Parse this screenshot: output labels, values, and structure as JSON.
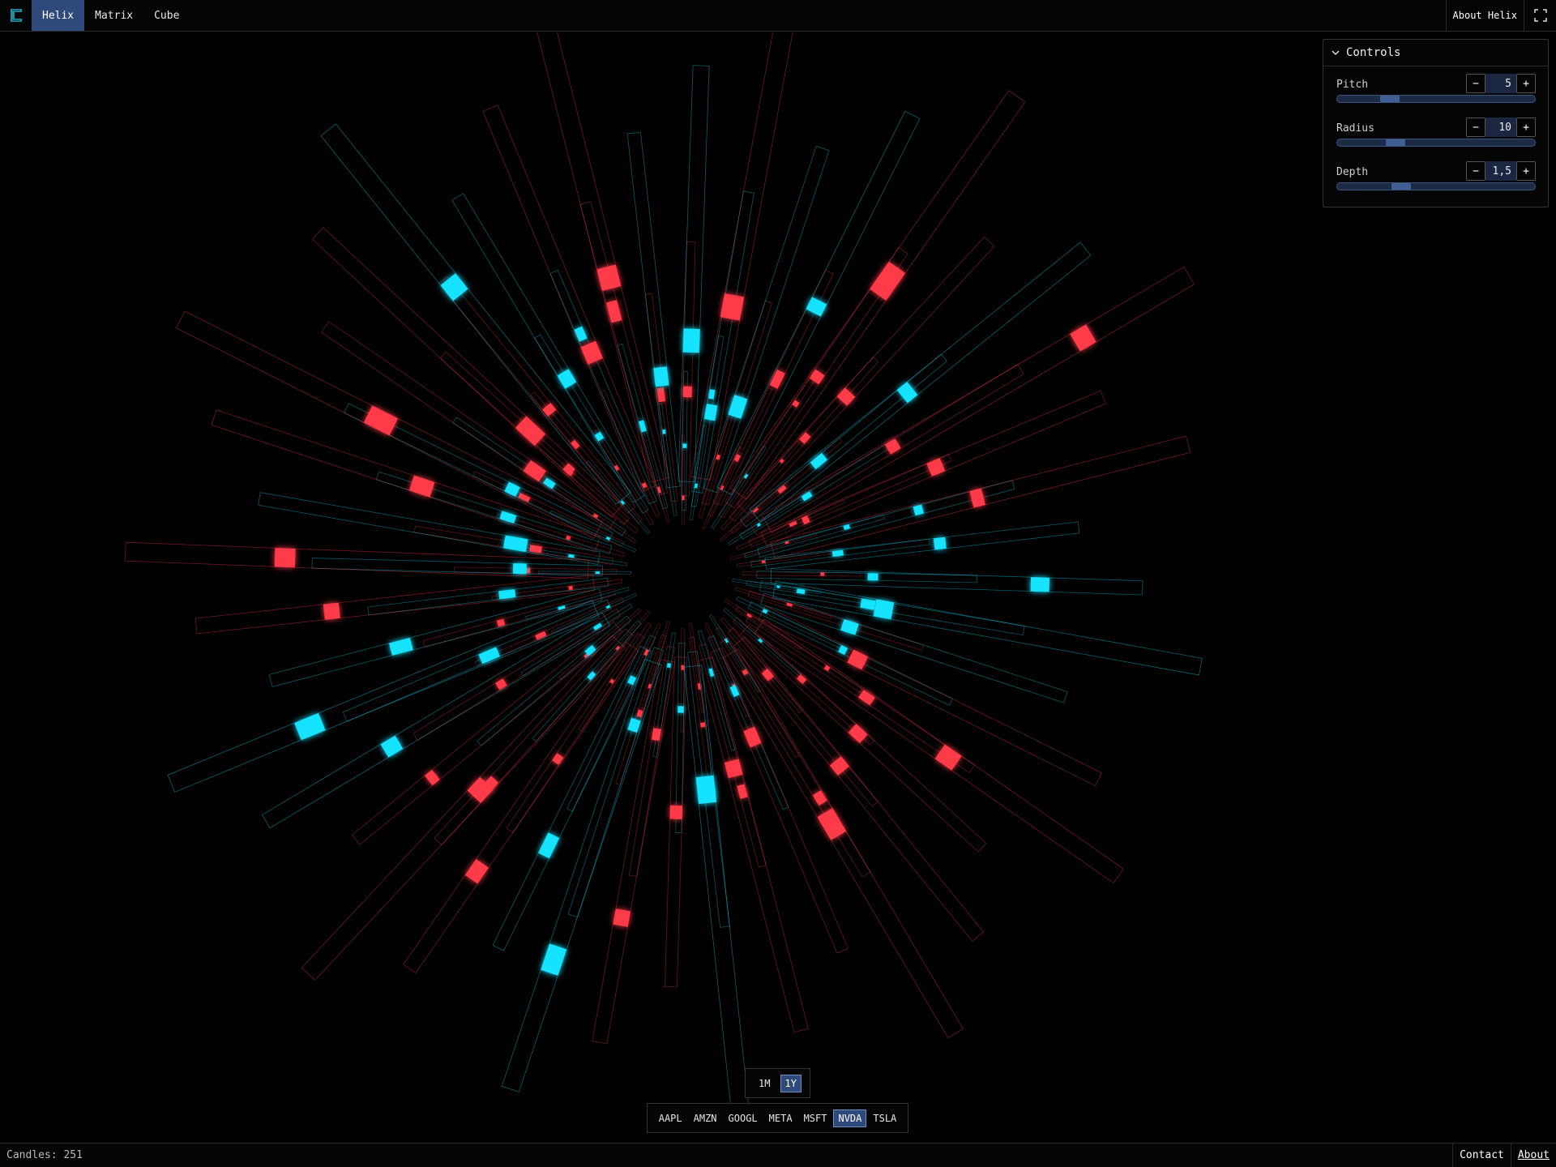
{
  "nav": {
    "logo_icon": "bracket-logo-icon",
    "tabs": [
      {
        "label": "Helix",
        "active": true
      },
      {
        "label": "Matrix",
        "active": false
      },
      {
        "label": "Cube",
        "active": false
      }
    ],
    "about_label": "About Helix",
    "fullscreen_icon": "fullscreen-icon"
  },
  "controls": {
    "title": "Controls",
    "toggle_icon": "chevron-down-icon",
    "params": [
      {
        "label": "Pitch",
        "value": "5",
        "minus": "−",
        "plus": "+",
        "level": 0.24
      },
      {
        "label": "Radius",
        "value": "10",
        "minus": "−",
        "plus": "+",
        "level": 0.27
      },
      {
        "label": "Depth",
        "value": "1,5",
        "minus": "−",
        "plus": "+",
        "level": 0.3
      }
    ]
  },
  "range": {
    "options": [
      "1M",
      "1Y"
    ],
    "selected": "1Y"
  },
  "tickers": {
    "options": [
      "AAPL",
      "AMZN",
      "GOOGL",
      "META",
      "MSFT",
      "NVDA",
      "TSLA"
    ],
    "selected": "NVDA"
  },
  "footer": {
    "candles_text": "Candles: 251",
    "contact_label": "Contact",
    "about_label": "About"
  },
  "colors": {
    "accent": "#2d4a7a",
    "up": "#19e3ff",
    "down": "#ff3b4a",
    "background": "#000000"
  }
}
